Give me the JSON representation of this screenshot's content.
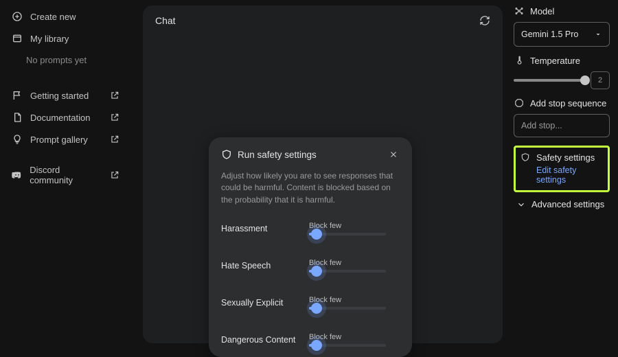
{
  "sidebar": {
    "create": "Create new",
    "library": "My library",
    "no_prompts": "No prompts yet",
    "getting_started": "Getting started",
    "documentation": "Documentation",
    "prompt_gallery": "Prompt gallery",
    "discord": "Discord community"
  },
  "chat": {
    "title": "Chat"
  },
  "rail": {
    "model_label": "Model",
    "model_value": "Gemini 1.5 Pro",
    "temperature_label": "Temperature",
    "temperature_value": "2",
    "temperature_pct": 100,
    "stop_label": "Add stop sequence",
    "stop_placeholder": "Add stop...",
    "safety_label": "Safety settings",
    "edit_safety": "Edit safety settings",
    "advanced": "Advanced settings"
  },
  "modal": {
    "title": "Run safety settings",
    "desc": "Adjust how likely you are to see responses that could be harmful. Content is blocked based on the probability that it is harmful.",
    "rows": [
      {
        "name": "Harassment",
        "level": "Block few"
      },
      {
        "name": "Hate Speech",
        "level": "Block few"
      },
      {
        "name": "Sexually Explicit",
        "level": "Block few"
      },
      {
        "name": "Dangerous Content",
        "level": "Block few"
      }
    ]
  }
}
